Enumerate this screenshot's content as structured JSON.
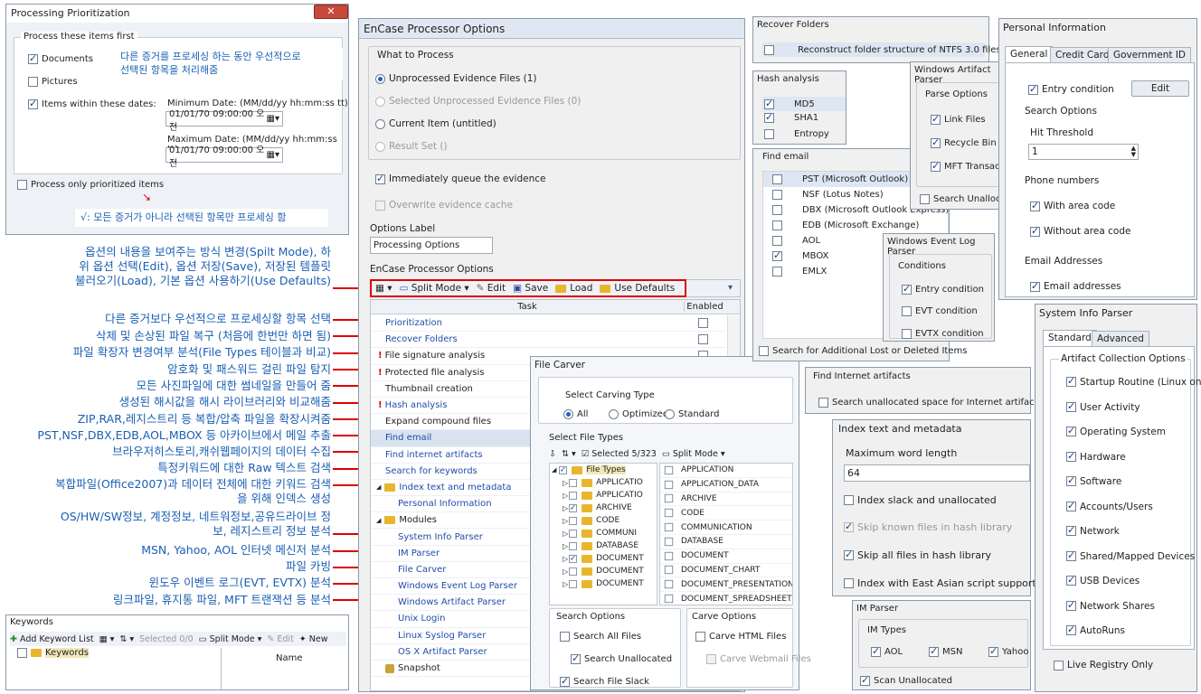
{
  "prioritization": {
    "title": "Processing Prioritization",
    "group": "Process these items first",
    "documents": "Documents",
    "pictures": "Pictures",
    "items_dates": "Items within these dates:",
    "min_date_label": "Minimum Date: (MM/dd/yy hh:mm:ss tt)",
    "min_date": "01/01/70 09:00:00 오전",
    "max_date_label": "Maximum Date: (MM/dd/yy hh:mm:ss tt)",
    "max_date": "01/01/70 09:00:00 오전",
    "only_prioritized": "Process only prioritized items",
    "note1": "다른 증거를 프로세싱 하는 동안 우선적으로",
    "note1b": "선택된 항목을 처리해줌",
    "note2": "√: 모든 증거가 아니라 선택된 항목만 프로세싱 함"
  },
  "annotations": {
    "a1": "옵션의 내용을 보여주는 방식 변경(Spilt Mode), 하",
    "a1b": "위 옵션 선택(Edit), 옵션 저장(Save), 저장된 템플릿",
    "a1c": "불러오기(Load), 기본 옵션 사용하기(Use Defaults)",
    "a2": "다른 증거보다 우선적으로 프로세싱할 항목 선택",
    "a3": "삭제 및 손상된 파일 복구 (처음에 한번만 하면 됨)",
    "a4": "파일 확장자 변경여부 분석(File Types 테이블과 비교)",
    "a5": "암호화 및 패스워드 걸린 파일 탐지",
    "a6": "모든 사진파일에 대한 썸네일을 만들어 줌",
    "a7": "생성된 해시값을 해시 라이브러리와 비교해줌",
    "a8": "ZIP,RAR,레지스트리 등 복합/압축 파일을 확장시켜줌",
    "a9": "PST,NSF,DBX,EDB,AOL,MBOX 등 아카이브에서 메일 추출",
    "a10": "브라우저히스토리,캐쉬웹페이지의 데이터 수집",
    "a11": "특정키워드에 대한 Raw 텍스트 검색",
    "a12": "복합파일(Office2007)과 데이터 전체에 대한 키워드 검색",
    "a12b": "을 위해 인덱스 생성",
    "a13": "OS/HW/SW정보, 계정정보, 네트워정보,공유드라이브 정",
    "a13b": "보, 레지스트리 정보 분석",
    "a14": "MSN, Yahoo, AOL 인터넷 메신저 분석",
    "a15": "파일 카빙",
    "a16": "윈도우 이벤트 로그(EVT, EVTX) 분석",
    "a17": "링크파일, 휴지통 파일, MFT 트랜잭션 등 분석"
  },
  "keywords": {
    "title": "Keywords",
    "add": "Add Keyword List",
    "selected": "Selected 0/0",
    "split": "Split Mode",
    "edit": "Edit",
    "new": "New",
    "root": "Keywords",
    "col": "Name"
  },
  "encase": {
    "title": "EnCase Processor Options",
    "wtp": "What to Process",
    "opt1": "Unprocessed Evidence Files (1)",
    "opt2": "Selected Unprocessed Evidence Files (0)",
    "opt3": "Current Item (untitled)",
    "opt4": "Result Set ()",
    "queue": "Immediately queue the evidence",
    "overwrite": "Overwrite evidence cache",
    "label_t": "Options Label",
    "label_v": "Processing Options",
    "opts_t": "EnCase Processor Options",
    "tb": {
      "split": "Split Mode",
      "edit": "Edit",
      "save": "Save",
      "load": "Load",
      "defaults": "Use Defaults"
    },
    "col_task": "Task",
    "col_enabled": "Enabled",
    "tasks": [
      "Prioritization",
      "Recover Folders",
      "File signature analysis",
      "Protected file analysis",
      "Thumbnail creation",
      "Hash analysis",
      "Expand compound files",
      "Find email",
      "Find internet artifacts",
      "Search for keywords",
      "Index text and metadata",
      "Personal Information",
      "Modules",
      "System Info Parser",
      "IM Parser",
      "File Carver",
      "Windows Event Log Parser",
      "Windows Artifact Parser",
      "Unix Login",
      "Linux Syslog Parser",
      "OS X Artifact Parser",
      "Snapshot"
    ]
  },
  "filecarver": {
    "title": "File Carver",
    "sel_type": "Select Carving Type",
    "all": "All",
    "optimized": "Optimized",
    "standard": "Standard",
    "sel_ft": "Select File Types",
    "selected": "Selected 5/323",
    "split": "Split Mode",
    "tree_root": "File Types",
    "tree": [
      "APPLICATIO",
      "APPLICATIO",
      "ARCHIVE",
      "CODE",
      "COMMUNI",
      "DATABASE",
      "DOCUMENT",
      "DOCUMENT",
      "DOCUMENT"
    ],
    "list": [
      "APPLICATION",
      "APPLICATION_DATA",
      "ARCHIVE",
      "CODE",
      "COMMUNICATION",
      "DATABASE",
      "DOCUMENT",
      "DOCUMENT_CHART",
      "DOCUMENT_PRESENTATION",
      "DOCUMENT_SPREADSHEET"
    ],
    "search_opts": "Search Options",
    "search_all": "Search All Files",
    "search_unalloc": "Search Unallocated",
    "search_slack": "Search File Slack",
    "carve_opts": "Carve Options",
    "carve_html": "Carve HTML Files",
    "carve_webmail": "Carve Webmail Files"
  },
  "recover": {
    "title": "Recover Folders",
    "item": "Reconstruct folder structure of NTFS 3.0 files"
  },
  "hash": {
    "title": "Hash analysis",
    "md5": "MD5",
    "sha1": "SHA1",
    "entropy": "Entropy"
  },
  "email": {
    "title": "Find email",
    "items": [
      "PST (Microsoft Outlook)",
      "NSF (Lotus Notes)",
      "DBX (Microsoft Outlook Express)",
      "EDB (Microsoft Exchange)",
      "AOL",
      "MBOX",
      "EMLX"
    ],
    "lost": "Search for Additional Lost or Deleted Items"
  },
  "artifact": {
    "title": "Windows Artifact Parser",
    "group": "Parse Options",
    "link": "Link Files",
    "recycle": "Recycle Bin Files",
    "mft": "MFT Transactions",
    "unalloc": "Search Unallocated"
  },
  "evtlog": {
    "title": "Windows Event Log Parser",
    "group": "Conditions",
    "entry": "Entry condition",
    "evt": "EVT condition",
    "evtx": "EVTX condition"
  },
  "internet": {
    "title": "Find Internet artifacts",
    "item": "Search unallocated space for Internet artifacts"
  },
  "index": {
    "title": "Index text and metadata",
    "max_label": "Maximum word length",
    "max_val": "64",
    "slack": "Index slack and unallocated",
    "skip_known": "Skip known files in hash library",
    "skip_all": "Skip all files in hash library",
    "asian": "Index with East Asian script support"
  },
  "im": {
    "title": "IM Parser",
    "group": "IM Types",
    "aol": "AOL",
    "msn": "MSN",
    "yahoo": "Yahoo",
    "scan": "Scan Unallocated"
  },
  "personal": {
    "title": "Personal Information",
    "tabs": [
      "General",
      "Credit Card",
      "Government ID"
    ],
    "entry": "Entry condition",
    "edit": "Edit",
    "search_opts": "Search Options",
    "hit": "Hit Threshold",
    "hit_val": "1",
    "phone": "Phone numbers",
    "with_area": "With area code",
    "without_area": "Without area code",
    "email_t": "Email Addresses",
    "email": "Email addresses"
  },
  "sysinfo": {
    "title": "System Info Parser",
    "tabs": [
      "Standard",
      "Advanced"
    ],
    "group": "Artifact Collection Options",
    "items": [
      "Startup Routine (Linux only)",
      "User Activity",
      "Operating System",
      "Hardware",
      "Software",
      "Accounts/Users",
      "Network",
      "Shared/Mapped Devices",
      "USB Devices",
      "Network Shares",
      "AutoRuns"
    ],
    "live": "Live Registry Only"
  }
}
